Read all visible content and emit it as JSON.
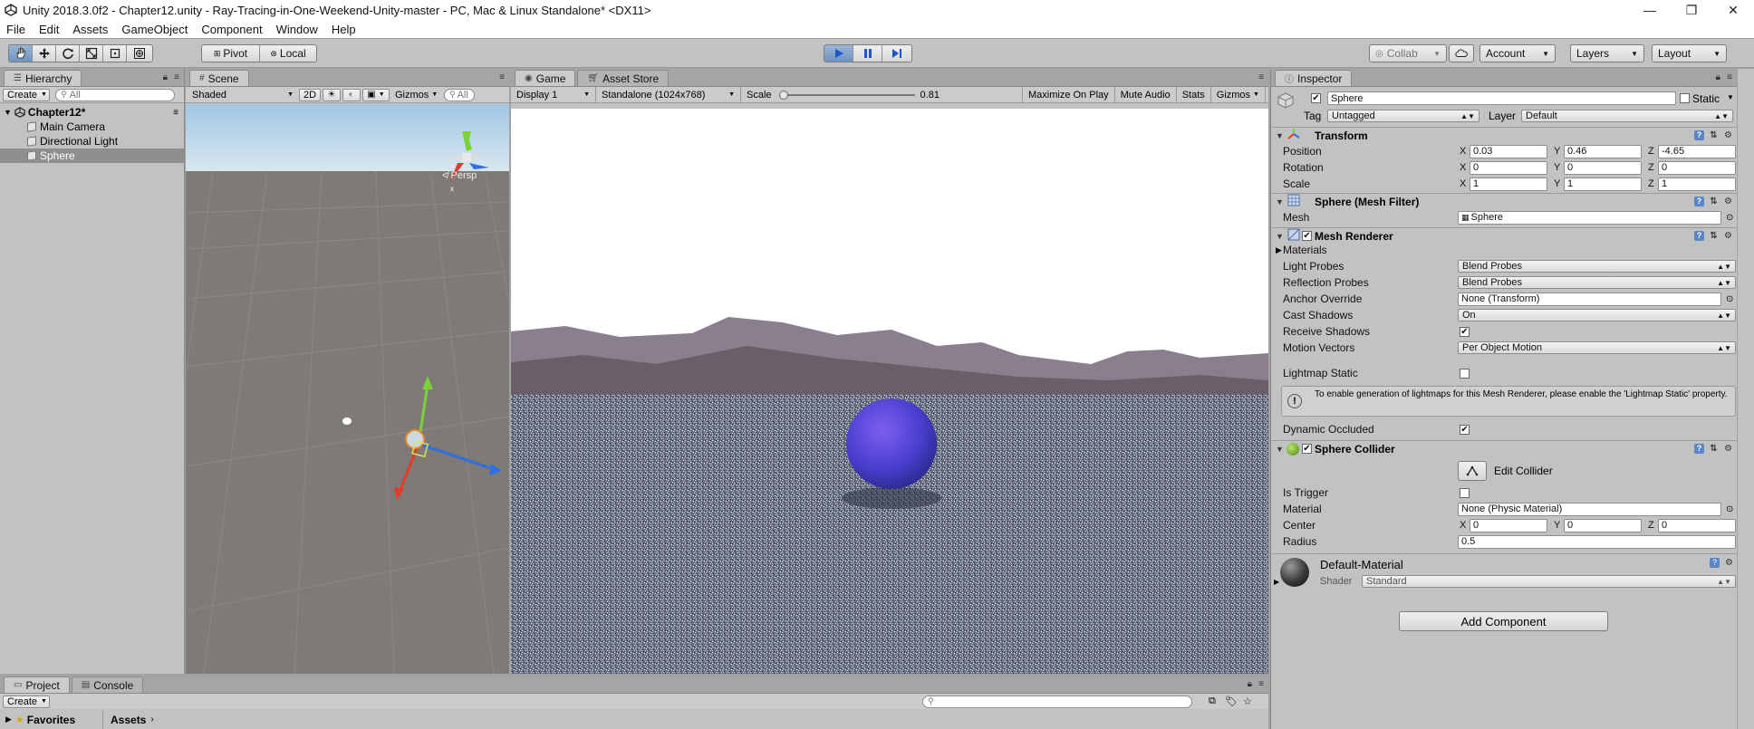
{
  "window": {
    "title": "Unity 2018.3.0f2 - Chapter12.unity - Ray-Tracing-in-One-Weekend-Unity-master - PC, Mac & Linux Standalone* <DX11>",
    "minimize": "—",
    "maximize": "❐",
    "close": "✕"
  },
  "menu": [
    "File",
    "Edit",
    "Assets",
    "GameObject",
    "Component",
    "Window",
    "Help"
  ],
  "toolbar": {
    "pivot": "Pivot",
    "local": "Local",
    "collab": "Collab",
    "account": "Account",
    "layers": "Layers",
    "layout": "Layout"
  },
  "hierarchy": {
    "tab": "Hierarchy",
    "create": "Create",
    "search_placeholder": "All",
    "scene": "Chapter12*",
    "items": [
      "Main Camera",
      "Directional Light",
      "Sphere"
    ],
    "selected": "Sphere"
  },
  "scene": {
    "tab": "Scene",
    "shading": "Shaded",
    "mode_2d": "2D",
    "gizmos": "Gizmos",
    "search": "All",
    "persp": "Persp"
  },
  "game": {
    "tab": "Game",
    "asset_store_tab": "Asset Store",
    "display": "Display 1",
    "resolution": "Standalone (1024x768)",
    "scale_label": "Scale",
    "scale_value": "0.81",
    "maximize_on_play": "Maximize On Play",
    "mute_audio": "Mute Audio",
    "stats": "Stats",
    "gizmos": "Gizmos"
  },
  "inspector": {
    "tab": "Inspector",
    "object_name": "Sphere",
    "static_label": "Static",
    "tag_label": "Tag",
    "tag_value": "Untagged",
    "layer_label": "Layer",
    "layer_value": "Default",
    "transform": {
      "title": "Transform",
      "position_label": "Position",
      "rotation_label": "Rotation",
      "scale_label": "Scale",
      "position": {
        "x": "0.03",
        "y": "0.46",
        "z": "-4.65"
      },
      "rotation": {
        "x": "0",
        "y": "0",
        "z": "0"
      },
      "scale": {
        "x": "1",
        "y": "1",
        "z": "1"
      }
    },
    "mesh_filter": {
      "title": "Sphere (Mesh Filter)",
      "mesh_label": "Mesh",
      "mesh_value": "Sphere"
    },
    "mesh_renderer": {
      "title": "Mesh Renderer",
      "materials_label": "Materials",
      "light_probes_label": "Light Probes",
      "light_probes_value": "Blend Probes",
      "reflection_probes_label": "Reflection Probes",
      "reflection_probes_value": "Blend Probes",
      "anchor_override_label": "Anchor Override",
      "anchor_override_value": "None (Transform)",
      "cast_shadows_label": "Cast Shadows",
      "cast_shadows_value": "On",
      "receive_shadows_label": "Receive Shadows",
      "motion_vectors_label": "Motion Vectors",
      "motion_vectors_value": "Per Object Motion",
      "lightmap_static_label": "Lightmap Static",
      "info_text": "To enable generation of lightmaps for this Mesh Renderer, please enable the 'Lightmap Static' property.",
      "dynamic_occluded_label": "Dynamic Occluded"
    },
    "sphere_collider": {
      "title": "Sphere Collider",
      "edit_collider": "Edit Collider",
      "is_trigger_label": "Is Trigger",
      "material_label": "Material",
      "material_value": "None (Physic Material)",
      "center_label": "Center",
      "center": {
        "x": "0",
        "y": "0",
        "z": "0"
      },
      "radius_label": "Radius",
      "radius_value": "0.5"
    },
    "material": {
      "name": "Default-Material",
      "shader_label": "Shader",
      "shader_value": "Standard"
    },
    "add_component": "Add Component",
    "axis_x": "X",
    "axis_y": "Y",
    "axis_z": "Z"
  },
  "project": {
    "tab": "Project",
    "console_tab": "Console",
    "create": "Create",
    "favorites": "Favorites",
    "assets": "Assets"
  },
  "colors": {
    "editor_bg": "#c2c2c2",
    "selection": "#8e8e8e",
    "play_active": "#6e93c0",
    "sphere": "#4a3fd0"
  }
}
